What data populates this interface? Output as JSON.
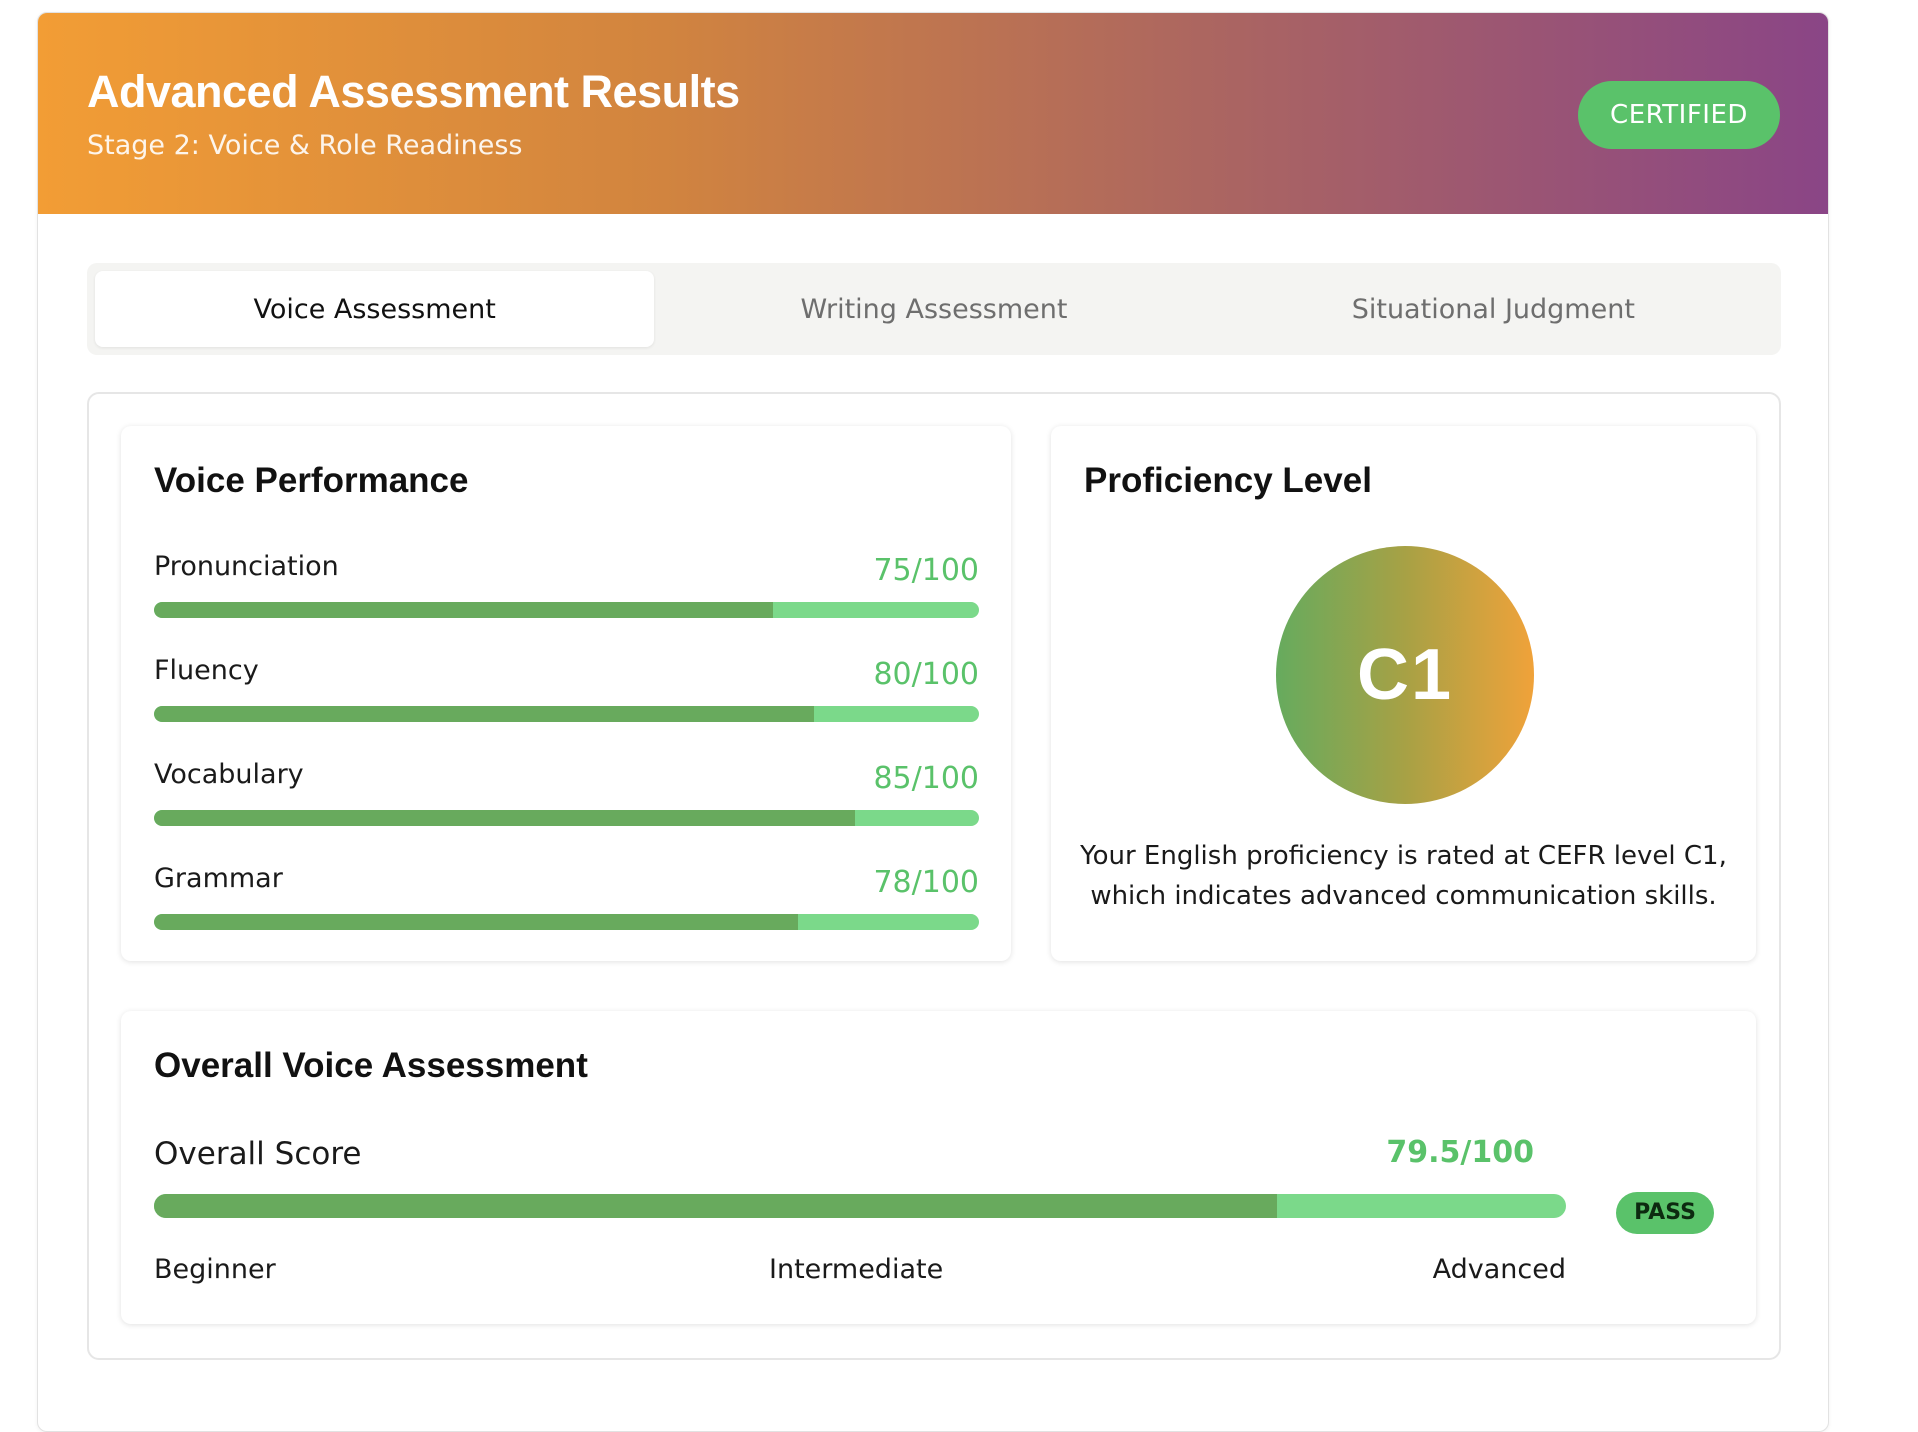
{
  "header": {
    "title": "Advanced Assessment Results",
    "subtitle": "Stage 2: Voice & Role Readiness",
    "badge": "CERTIFIED"
  },
  "tabs": [
    {
      "label": "Voice Assessment",
      "active": true
    },
    {
      "label": "Writing Assessment",
      "active": false
    },
    {
      "label": "Situational Judgment",
      "active": false
    }
  ],
  "voice_performance": {
    "title": "Voice Performance",
    "metrics": [
      {
        "label": "Pronunciation",
        "value": "75/100",
        "score": 75
      },
      {
        "label": "Fluency",
        "value": "80/100",
        "score": 80
      },
      {
        "label": "Vocabulary",
        "value": "85/100",
        "score": 85
      },
      {
        "label": "Grammar",
        "value": "78/100",
        "score": 78
      }
    ]
  },
  "proficiency": {
    "title": "Proficiency Level",
    "level": "C1",
    "description": "Your English proficiency is rated at CEFR level C1, which indicates advanced communication skills."
  },
  "overall": {
    "title": "Overall Voice Assessment",
    "label": "Overall Score",
    "value": "79.5/100",
    "score": 79.5,
    "badge": "PASS",
    "scale": [
      "Beginner",
      "Intermediate",
      "Advanced"
    ]
  },
  "colors": {
    "accent_green": "#5ac26a",
    "bar_fill": "#68aa5d",
    "bar_track": "#7bd98a",
    "header_gradient_start": "#f29d35",
    "header_gradient_end": "#8a4586"
  }
}
